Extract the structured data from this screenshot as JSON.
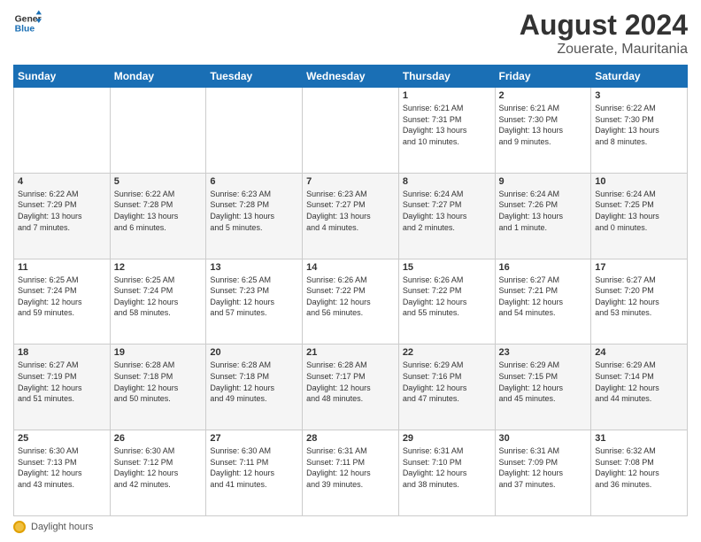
{
  "header": {
    "logo_general": "General",
    "logo_blue": "Blue",
    "month_year": "August 2024",
    "location": "Zouerate, Mauritania"
  },
  "days_of_week": [
    "Sunday",
    "Monday",
    "Tuesday",
    "Wednesday",
    "Thursday",
    "Friday",
    "Saturday"
  ],
  "footer": {
    "daylight_label": "Daylight hours"
  },
  "weeks": [
    [
      {
        "day": "",
        "info": ""
      },
      {
        "day": "",
        "info": ""
      },
      {
        "day": "",
        "info": ""
      },
      {
        "day": "",
        "info": ""
      },
      {
        "day": "1",
        "info": "Sunrise: 6:21 AM\nSunset: 7:31 PM\nDaylight: 13 hours\nand 10 minutes."
      },
      {
        "day": "2",
        "info": "Sunrise: 6:21 AM\nSunset: 7:30 PM\nDaylight: 13 hours\nand 9 minutes."
      },
      {
        "day": "3",
        "info": "Sunrise: 6:22 AM\nSunset: 7:30 PM\nDaylight: 13 hours\nand 8 minutes."
      }
    ],
    [
      {
        "day": "4",
        "info": "Sunrise: 6:22 AM\nSunset: 7:29 PM\nDaylight: 13 hours\nand 7 minutes."
      },
      {
        "day": "5",
        "info": "Sunrise: 6:22 AM\nSunset: 7:28 PM\nDaylight: 13 hours\nand 6 minutes."
      },
      {
        "day": "6",
        "info": "Sunrise: 6:23 AM\nSunset: 7:28 PM\nDaylight: 13 hours\nand 5 minutes."
      },
      {
        "day": "7",
        "info": "Sunrise: 6:23 AM\nSunset: 7:27 PM\nDaylight: 13 hours\nand 4 minutes."
      },
      {
        "day": "8",
        "info": "Sunrise: 6:24 AM\nSunset: 7:27 PM\nDaylight: 13 hours\nand 2 minutes."
      },
      {
        "day": "9",
        "info": "Sunrise: 6:24 AM\nSunset: 7:26 PM\nDaylight: 13 hours\nand 1 minute."
      },
      {
        "day": "10",
        "info": "Sunrise: 6:24 AM\nSunset: 7:25 PM\nDaylight: 13 hours\nand 0 minutes."
      }
    ],
    [
      {
        "day": "11",
        "info": "Sunrise: 6:25 AM\nSunset: 7:24 PM\nDaylight: 12 hours\nand 59 minutes."
      },
      {
        "day": "12",
        "info": "Sunrise: 6:25 AM\nSunset: 7:24 PM\nDaylight: 12 hours\nand 58 minutes."
      },
      {
        "day": "13",
        "info": "Sunrise: 6:25 AM\nSunset: 7:23 PM\nDaylight: 12 hours\nand 57 minutes."
      },
      {
        "day": "14",
        "info": "Sunrise: 6:26 AM\nSunset: 7:22 PM\nDaylight: 12 hours\nand 56 minutes."
      },
      {
        "day": "15",
        "info": "Sunrise: 6:26 AM\nSunset: 7:22 PM\nDaylight: 12 hours\nand 55 minutes."
      },
      {
        "day": "16",
        "info": "Sunrise: 6:27 AM\nSunset: 7:21 PM\nDaylight: 12 hours\nand 54 minutes."
      },
      {
        "day": "17",
        "info": "Sunrise: 6:27 AM\nSunset: 7:20 PM\nDaylight: 12 hours\nand 53 minutes."
      }
    ],
    [
      {
        "day": "18",
        "info": "Sunrise: 6:27 AM\nSunset: 7:19 PM\nDaylight: 12 hours\nand 51 minutes."
      },
      {
        "day": "19",
        "info": "Sunrise: 6:28 AM\nSunset: 7:18 PM\nDaylight: 12 hours\nand 50 minutes."
      },
      {
        "day": "20",
        "info": "Sunrise: 6:28 AM\nSunset: 7:18 PM\nDaylight: 12 hours\nand 49 minutes."
      },
      {
        "day": "21",
        "info": "Sunrise: 6:28 AM\nSunset: 7:17 PM\nDaylight: 12 hours\nand 48 minutes."
      },
      {
        "day": "22",
        "info": "Sunrise: 6:29 AM\nSunset: 7:16 PM\nDaylight: 12 hours\nand 47 minutes."
      },
      {
        "day": "23",
        "info": "Sunrise: 6:29 AM\nSunset: 7:15 PM\nDaylight: 12 hours\nand 45 minutes."
      },
      {
        "day": "24",
        "info": "Sunrise: 6:29 AM\nSunset: 7:14 PM\nDaylight: 12 hours\nand 44 minutes."
      }
    ],
    [
      {
        "day": "25",
        "info": "Sunrise: 6:30 AM\nSunset: 7:13 PM\nDaylight: 12 hours\nand 43 minutes."
      },
      {
        "day": "26",
        "info": "Sunrise: 6:30 AM\nSunset: 7:12 PM\nDaylight: 12 hours\nand 42 minutes."
      },
      {
        "day": "27",
        "info": "Sunrise: 6:30 AM\nSunset: 7:11 PM\nDaylight: 12 hours\nand 41 minutes."
      },
      {
        "day": "28",
        "info": "Sunrise: 6:31 AM\nSunset: 7:11 PM\nDaylight: 12 hours\nand 39 minutes."
      },
      {
        "day": "29",
        "info": "Sunrise: 6:31 AM\nSunset: 7:10 PM\nDaylight: 12 hours\nand 38 minutes."
      },
      {
        "day": "30",
        "info": "Sunrise: 6:31 AM\nSunset: 7:09 PM\nDaylight: 12 hours\nand 37 minutes."
      },
      {
        "day": "31",
        "info": "Sunrise: 6:32 AM\nSunset: 7:08 PM\nDaylight: 12 hours\nand 36 minutes."
      }
    ]
  ]
}
